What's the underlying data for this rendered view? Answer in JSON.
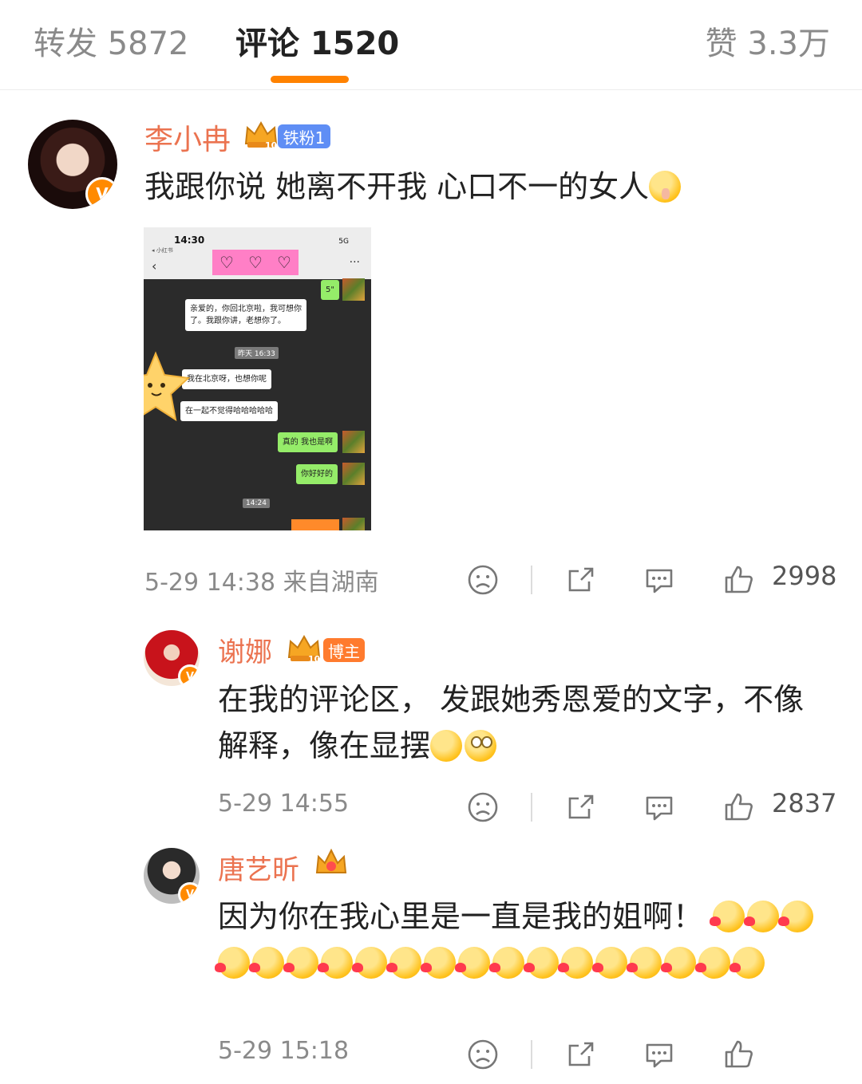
{
  "tabs": {
    "repost": "转发 5872",
    "comments": "评论 1520",
    "likes": "赞 3.3万"
  },
  "comments": [
    {
      "name": "李小冉",
      "badge": "铁粉1",
      "text": "我跟你说 她离不开我 心口不一的女人",
      "emojis": [
        "shushing-face-emoji"
      ],
      "meta": "5-29 14:38 来自湖南",
      "likes": "2998"
    },
    {
      "name": "谢娜",
      "badge": "博主",
      "text": "在我的评论区， 发跟她秀恩爱的文字，不像解释，像在显摆",
      "emojis": [
        "huffing-face-emoji",
        "eye-roll-emoji"
      ],
      "meta": "5-29 14:55",
      "likes": "2837"
    },
    {
      "name": "唐艺昕",
      "text": "因为你在我心里是一直是我的姐啊！",
      "emoji_count": 19,
      "meta": "5-29 15:18"
    }
  ],
  "screenshot": {
    "time": "14:30",
    "app": "◂ 小红书",
    "signal": "5G",
    "hearts": [
      "♡",
      "♡",
      "♡"
    ],
    "voice": "5\"",
    "msg1": "亲爱的，你回北京啦，我可想你",
    "msg1b": "了。我跟你讲，老想你了。",
    "ts1": "昨天 16:33",
    "msg2": "我在北京呀，也想你呢",
    "msg3": "在一起不觉得哈哈哈哈哈",
    "msg4": "真的 我也是啊",
    "msg5": "你好好的",
    "ts2": "14:24"
  },
  "colors": {
    "accent": "#ff8200",
    "name": "#eb7350",
    "fan_badge": "#5f8ef5",
    "blogger_badge": "#ff7b2e"
  },
  "icons": [
    "dislike-face-icon",
    "repost-icon",
    "comment-icon",
    "like-thumb-icon"
  ]
}
